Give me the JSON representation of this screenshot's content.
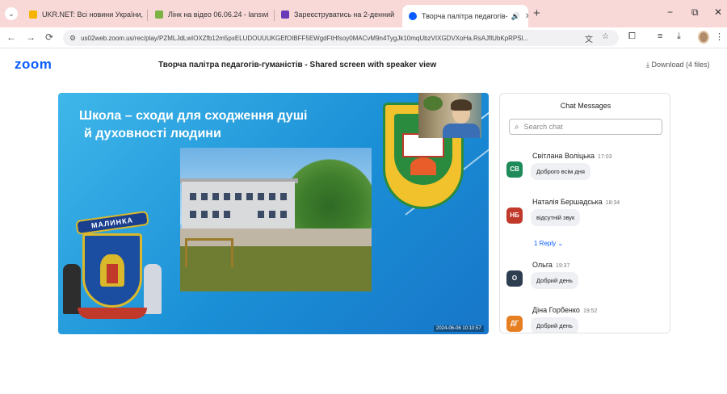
{
  "browser": {
    "tabs": [
      {
        "label": "UKR.NET: Всі новини України,",
        "favicon_color": "#f5b400"
      },
      {
        "label": "Лінк на відео 06.06.24 - lanswi",
        "favicon_color": "#7cb342"
      },
      {
        "label": "Зареєструватись на 2-денний",
        "favicon_color": "#673ab7"
      },
      {
        "label": "Творча палітра педагогів-",
        "favicon_color": "#0b5cff"
      }
    ],
    "address": "us02web.zoom.us/rec/play/PZMLJdLwIOXZfb12m5pxELUDOUUUKGEfOIBFF5EWgdFtHfsoy0MACvM9n4TygJk10mqUbzVIXGDVXoHa.RsAJflUbKpRPSl..."
  },
  "zoom": {
    "logo": "zoom",
    "page_title": "Творча палітра педагогів-гуманістів - Shared screen with speaker view",
    "download_label": "Download (4 files)"
  },
  "slide": {
    "title_line1": "Школа – сходи для сходження душі",
    "title_line2": "й духовності людини",
    "coat_banner": "МАЛИНКА",
    "timestamp": "2024-06-06  10:10:57"
  },
  "chat": {
    "title": "Chat Messages",
    "search_placeholder": "Search chat",
    "messages": [
      {
        "initials": "СВ",
        "color": "#1f8a5a",
        "name": "Світлана Воліцька",
        "time": "17:03",
        "text": "Доброго всім дня"
      },
      {
        "initials": "НБ",
        "color": "#c0392b",
        "name": "Наталія Бершадська",
        "time": "18:34",
        "text": "відсутній звук",
        "reply": "1 Reply"
      },
      {
        "initials": "О",
        "color": "#2c3e50",
        "name": "Ольга",
        "time": "19:37",
        "text": "Добрий день"
      },
      {
        "initials": "ДГ",
        "color": "#e67e22",
        "name": "Діна Горбенко",
        "time": "19:52",
        "text": "Добрий день"
      }
    ]
  }
}
